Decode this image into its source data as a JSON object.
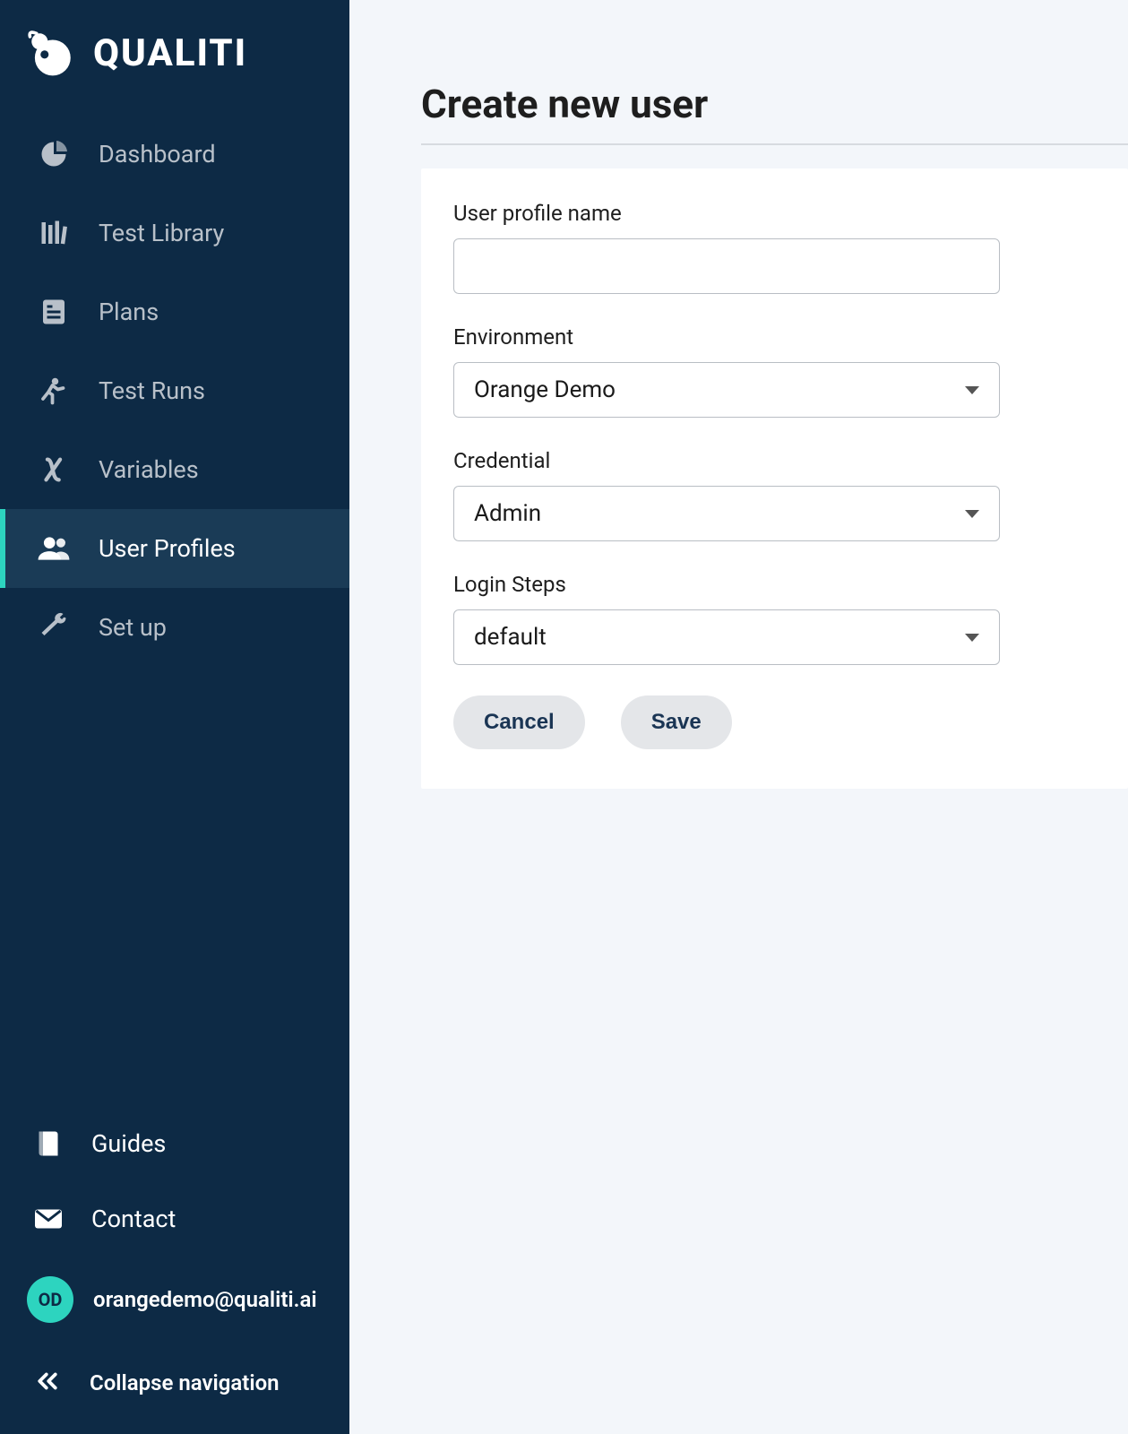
{
  "brand": {
    "name": "QUALITI"
  },
  "sidebar": {
    "items": [
      {
        "label": "Dashboard"
      },
      {
        "label": "Test Library"
      },
      {
        "label": "Plans"
      },
      {
        "label": "Test Runs"
      },
      {
        "label": "Variables"
      },
      {
        "label": "User Profiles"
      },
      {
        "label": "Set up"
      }
    ],
    "bottom": {
      "guides": "Guides",
      "contact": "Contact",
      "collapse": "Collapse navigation"
    },
    "account": {
      "initials": "OD",
      "email": "orangedemo@qualiti.ai"
    }
  },
  "page": {
    "title": "Create new user",
    "fields": {
      "profile_name": {
        "label": "User profile name",
        "value": ""
      },
      "environment": {
        "label": "Environment",
        "value": "Orange Demo"
      },
      "credential": {
        "label": "Credential",
        "value": "Admin"
      },
      "login_steps": {
        "label": "Login Steps",
        "value": "default"
      }
    },
    "buttons": {
      "cancel": "Cancel",
      "save": "Save"
    }
  }
}
